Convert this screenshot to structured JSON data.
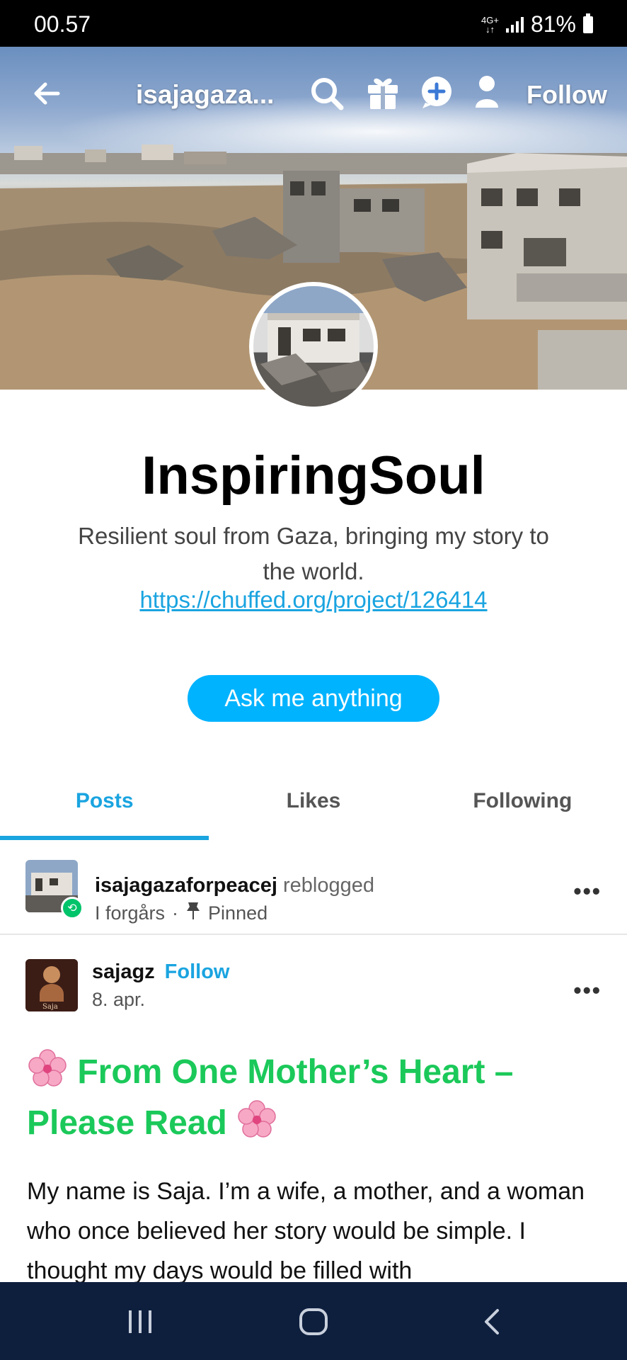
{
  "status_bar": {
    "time": "00.57",
    "network": "4G+",
    "battery": "81%"
  },
  "header": {
    "title": "isajagaza...",
    "follow_label": "Follow",
    "icons": [
      "back-arrow-icon",
      "search-icon",
      "gift-icon",
      "add-message-icon",
      "person-icon"
    ]
  },
  "profile": {
    "name": "InspiringSoul",
    "bio_line1": "Resilient soul from Gaza, bringing my story to",
    "bio_line2": "the world.",
    "link": "https://chuffed.org/project/126414",
    "ask_label": "Ask me anything"
  },
  "tabs": [
    {
      "label": "Posts",
      "active": true
    },
    {
      "label": "Likes",
      "active": false
    },
    {
      "label": "Following",
      "active": false
    }
  ],
  "reblog_post": {
    "user": "isajagazaforpeacej",
    "action": "reblogged",
    "time": "I forgårs",
    "separator": "·",
    "pinned": "Pinned"
  },
  "post": {
    "user": "sajagz",
    "follow_label": "Follow",
    "date": "8. apr.",
    "avatar_text": "Saja",
    "title_part1": "From One Mother’s Heart –",
    "title_part2": "Please Read",
    "body": "My name is Saja. I’m a wife, a mother, and a woman who once believed her story would be simple. I thought my days would be filled with"
  },
  "colors": {
    "accent": "#1aa4e0",
    "ask_button": "#00b3ff",
    "title_green": "#1bc95a",
    "nav_bar": "#0e1f3e"
  }
}
